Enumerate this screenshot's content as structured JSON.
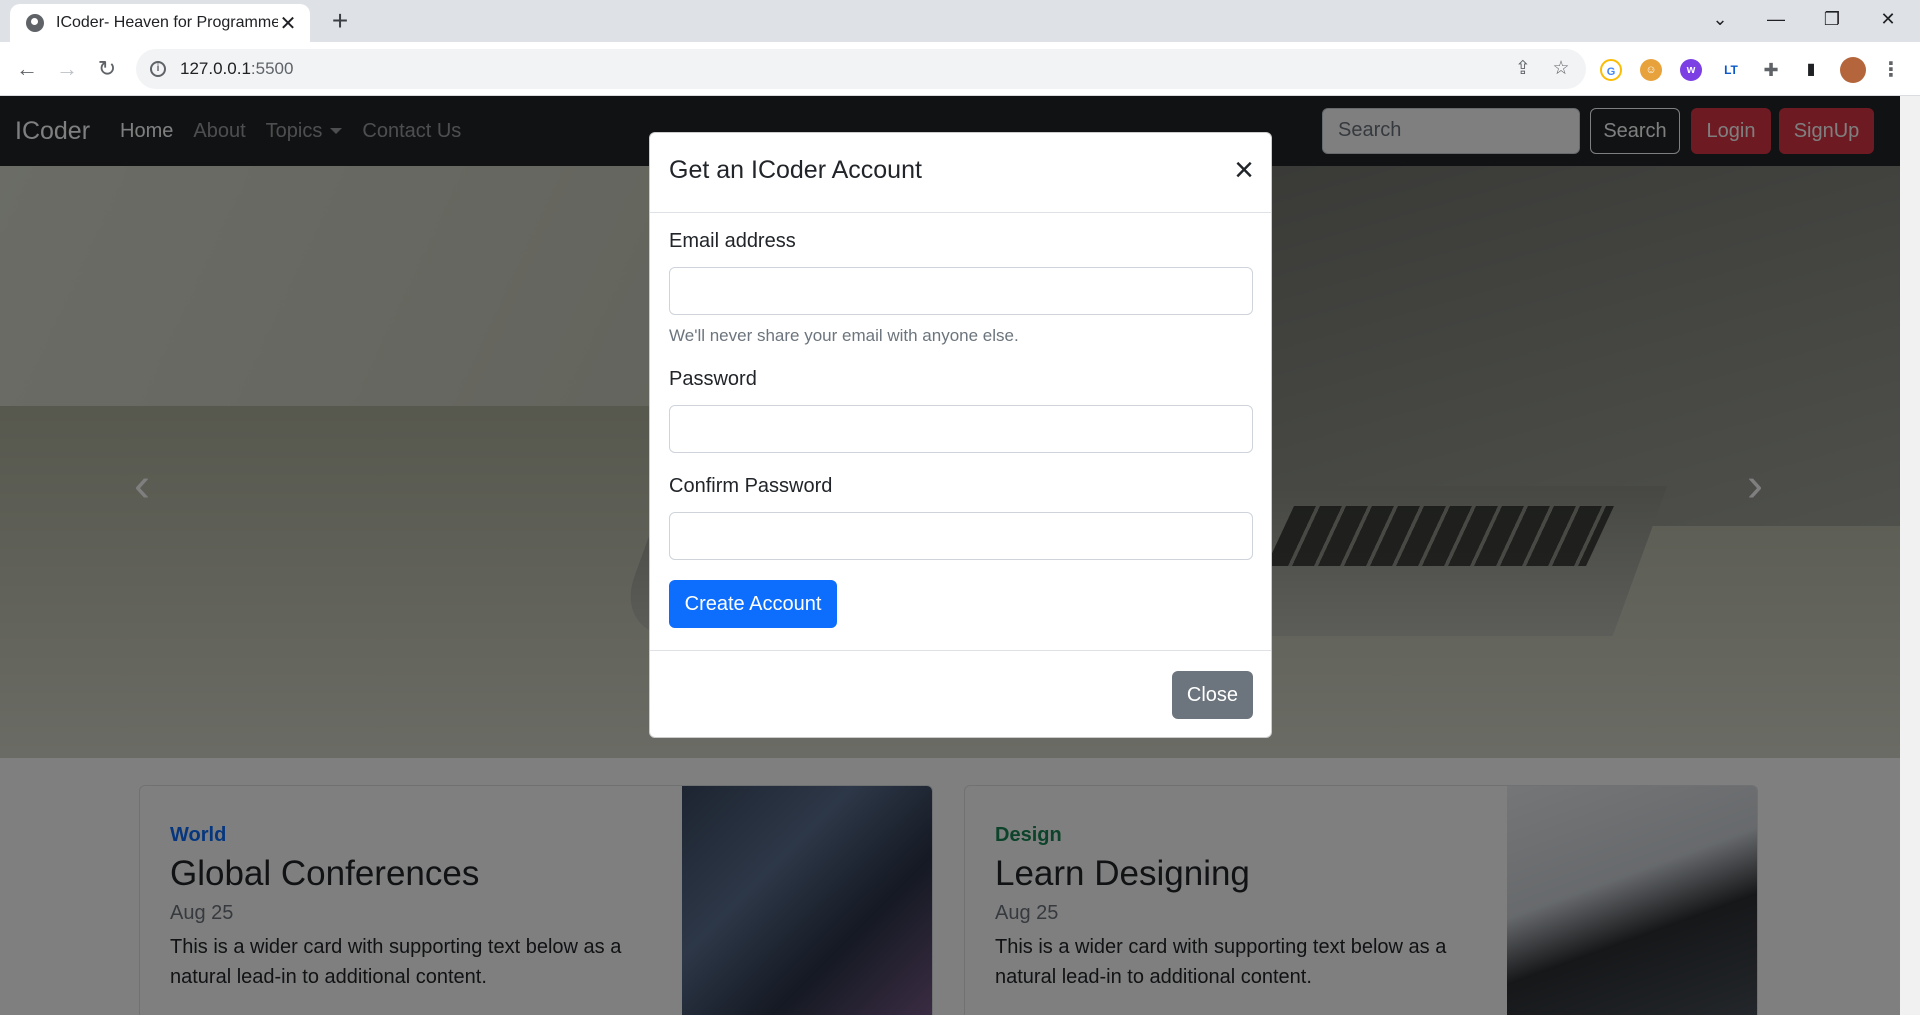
{
  "browser": {
    "tab_title": "ICoder- Heaven for Programmers",
    "url_host": "127.0.0.1",
    "url_port": ":5500"
  },
  "navbar": {
    "brand": "ICoder",
    "links": [
      "Home",
      "About",
      "Topics",
      "Contact Us"
    ],
    "search_placeholder": "Search",
    "search_button": "Search",
    "login_button": "Login",
    "signup_button": "SignUp"
  },
  "cards": [
    {
      "category": "World",
      "category_color": "#0d6efd",
      "title": "Global Conferences",
      "date": "Aug 25",
      "text": "This is a wider card with supporting text below as a natural lead-in to additional content."
    },
    {
      "category": "Design",
      "category_color": "#198754",
      "title": "Learn Designing",
      "date": "Aug 25",
      "text": "This is a wider card with supporting text below as a natural lead-in to additional content."
    }
  ],
  "modal": {
    "title": "Get an ICoder Account",
    "email_label": "Email address",
    "email_help": "We'll never share your email with anyone else.",
    "password_label": "Password",
    "confirm_label": "Confirm Password",
    "create_button": "Create Account",
    "close_button": "Close"
  },
  "colors": {
    "primary": "#0d6efd",
    "danger": "#dc3545",
    "secondary": "#6c757d",
    "navbar_bg": "#212529"
  }
}
